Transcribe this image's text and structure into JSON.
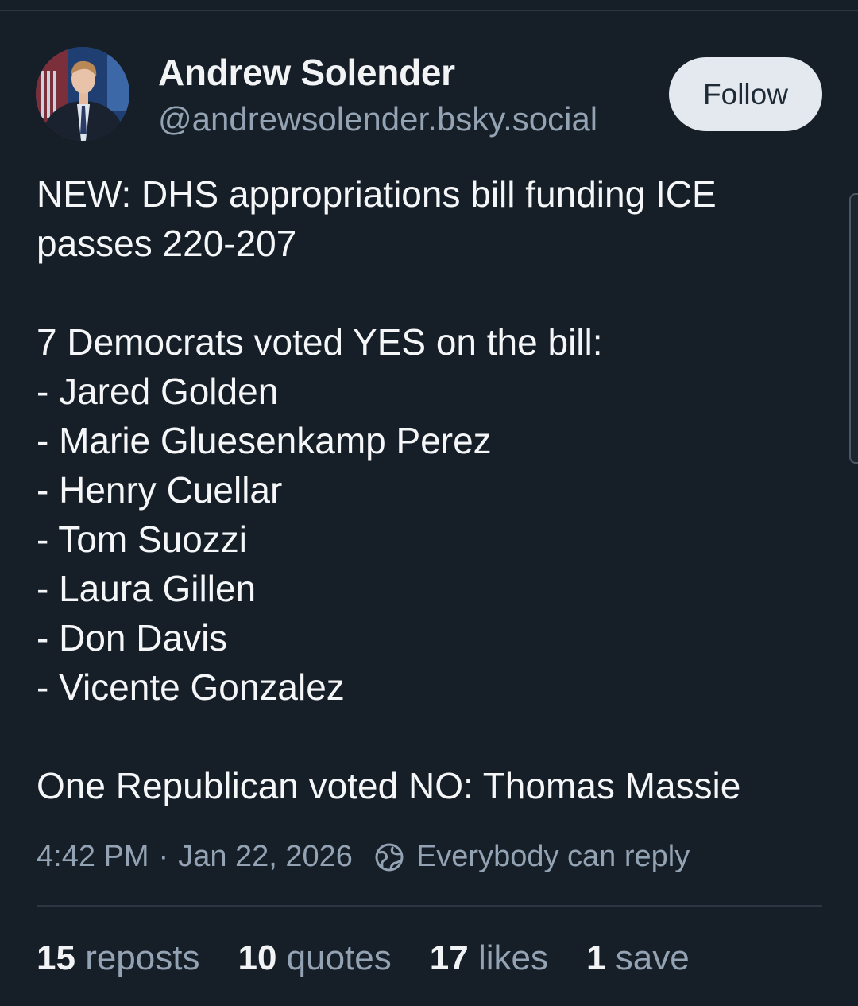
{
  "author": {
    "name": "Andrew Solender",
    "handle": "@andrewsolender.bsky.social"
  },
  "follow_label": "Follow",
  "post": {
    "lines": [
      "NEW: DHS appropriations bill funding ICE",
      "passes 220-207",
      "7 Democrats voted YES on the bill:",
      "- Jared Golden",
      "- Marie Gluesenkamp Perez",
      "- Henry Cuellar",
      "- Tom Suozzi",
      "- Laura Gillen",
      "- Don Davis",
      "- Vicente Gonzalez",
      "One Republican voted NO: Thomas Massie"
    ]
  },
  "meta": {
    "time": "4:42 PM",
    "separator": "·",
    "date": "Jan 22, 2026",
    "reply_setting": "Everybody can reply",
    "reply_icon": "globe-icon"
  },
  "stats": [
    {
      "count": "15",
      "label": "reposts"
    },
    {
      "count": "10",
      "label": "quotes"
    },
    {
      "count": "17",
      "label": "likes"
    },
    {
      "count": "1",
      "label": "save"
    }
  ],
  "colors": {
    "background": "#161e27",
    "text": "#f1f3f5",
    "muted": "#93a3b4",
    "follow_bg": "#e4e9ef"
  }
}
